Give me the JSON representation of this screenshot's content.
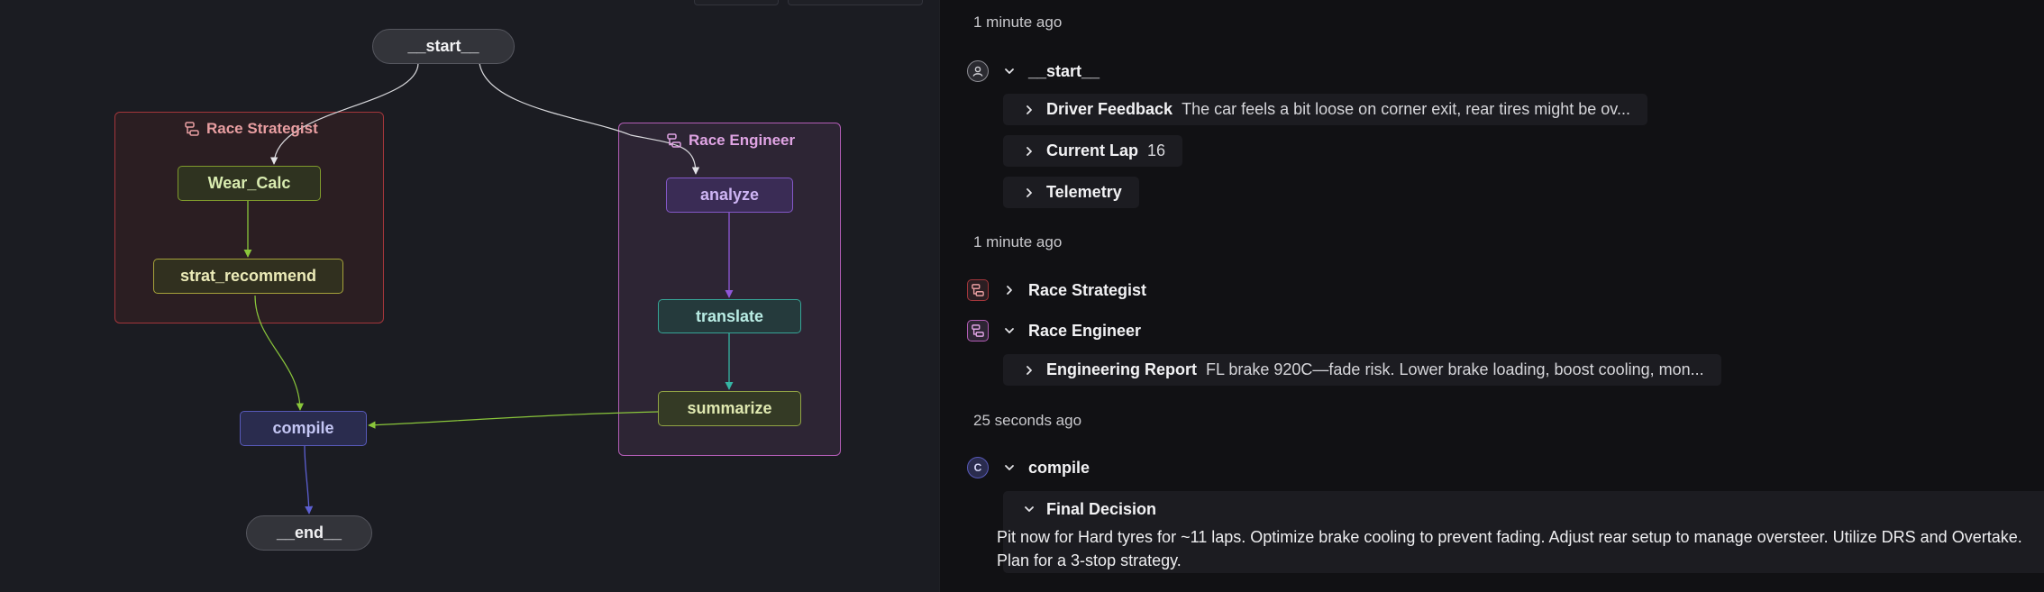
{
  "graph": {
    "nodes": {
      "start": "__start__",
      "wear_calc": "Wear_Calc",
      "strat_recommend": "strat_recommend",
      "analyze": "analyze",
      "translate": "translate",
      "summarize": "summarize",
      "compile": "compile",
      "end": "__end__"
    },
    "groups": {
      "race_strategist": "Race Strategist",
      "race_engineer": "Race Engineer"
    },
    "colors": {
      "strategist": "#c0494d",
      "engineer": "#c26ac6",
      "edge_default": "#d9d9dd",
      "edge_lime": "#8ac63b",
      "edge_purple": "#8f57d8",
      "edge_teal": "#35b5a4",
      "edge_indigo": "#5c5fd1"
    }
  },
  "run": {
    "ts1": "1 minute ago",
    "start_label": "__start__",
    "driver_feedback": {
      "key": "Driver Feedback",
      "value": "The car feels a bit loose on corner exit, rear tires might be ov..."
    },
    "current_lap": {
      "key": "Current Lap",
      "value": "16"
    },
    "telemetry": {
      "key": "Telemetry"
    },
    "ts2": "1 minute ago",
    "race_strategist": "Race Strategist",
    "race_engineer": "Race Engineer",
    "engineering_report": {
      "key": "Engineering Report",
      "value": "FL brake 920C—fade risk. Lower brake loading, boost cooling, mon..."
    },
    "ts3": "25 seconds ago",
    "compile_avatar": "C",
    "compile_label": "compile",
    "final_decision": {
      "key": "Final Decision",
      "text": "Pit now for Hard tyres for ~11 laps. Optimize brake cooling to prevent fading. Adjust rear setup to manage oversteer. Utilize DRS and Overtake. Plan for a 3-stop strategy."
    }
  }
}
